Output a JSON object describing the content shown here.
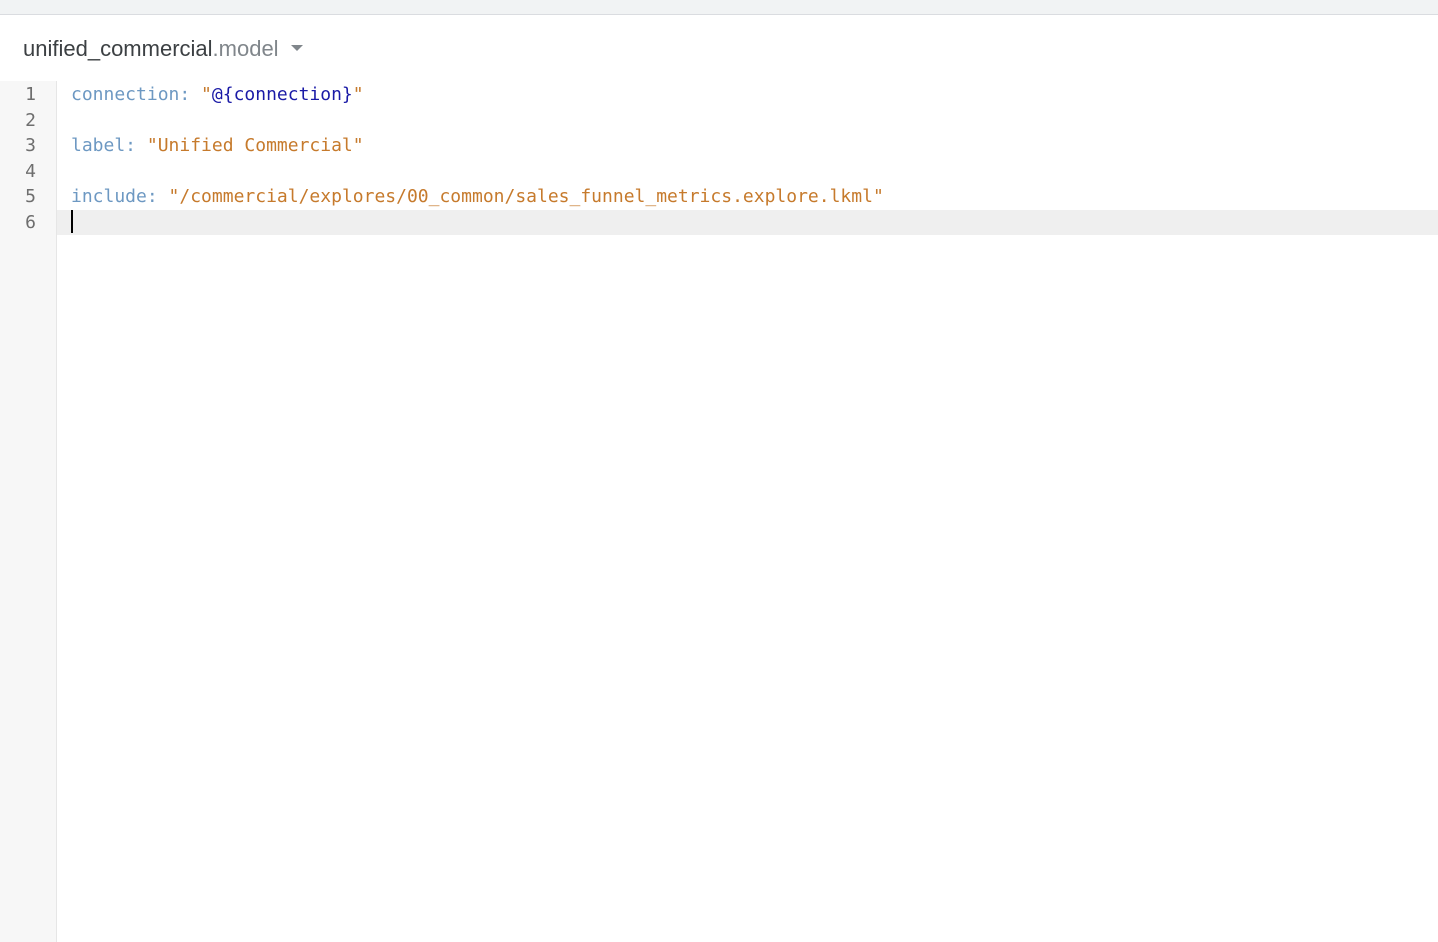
{
  "file": {
    "name": "unified_commercial",
    "extension": ".model",
    "dropdown_icon": "caret-down-icon"
  },
  "editor": {
    "line_numbers": [
      "1",
      "2",
      "3",
      "4",
      "5",
      "6"
    ],
    "active_line": 6,
    "lines": {
      "l1": {
        "key": "connection: ",
        "quote_open": "\"",
        "value": "@{connection}",
        "quote_close": "\""
      },
      "l3": {
        "key": "label: ",
        "value": "\"Unified Commercial\""
      },
      "l5": {
        "key": "include: ",
        "value": "\"/commercial/explores/00_common/sales_funnel_metrics.explore.lkml\""
      }
    }
  },
  "colors": {
    "key": "#6d98c2",
    "string": "#c67a2c",
    "substitution": "#1a1aa6",
    "active_line_bg": "#efefef",
    "gutter_bg": "#f7f7f7"
  }
}
